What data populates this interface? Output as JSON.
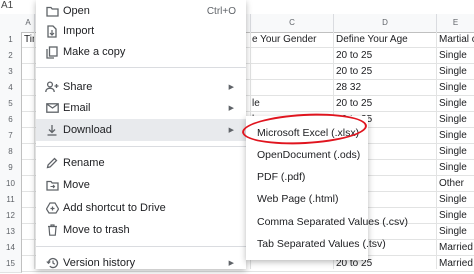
{
  "namebox": "A1",
  "sheet": {
    "columns": [
      "A",
      "B",
      "C",
      "D",
      "E"
    ],
    "rows": [
      "1",
      "2",
      "3",
      "4",
      "5",
      "6",
      "7",
      "8",
      "9",
      "10",
      "11",
      "12",
      "13",
      "14",
      "15"
    ],
    "row1": {
      "a": "Tin",
      "c": "e Your Gender",
      "d": "Define Your Age",
      "e": "Martial c"
    },
    "c_values": [
      "",
      "",
      "",
      "le",
      "le",
      "le",
      "",
      "",
      "",
      "",
      "",
      "",
      "",
      ""
    ],
    "d_values": [
      "20 to 25",
      "20 to 25",
      "28 32",
      "20 to 25",
      "20 to 25",
      "",
      "",
      "",
      "",
      "",
      "",
      "",
      "",
      "20 to 25"
    ],
    "e_values": [
      "Single",
      "Single",
      "Single",
      "Single",
      "Single",
      "Single",
      "Single",
      "Single",
      "Other",
      "Single",
      "Single",
      "Single",
      "Married",
      "Married"
    ]
  },
  "menu": {
    "open": "Open",
    "open_shortcut": "Ctrl+O",
    "import": "Import",
    "make_copy": "Make a copy",
    "share": "Share",
    "email": "Email",
    "download": "Download",
    "rename": "Rename",
    "move": "Move",
    "add_shortcut": "Add shortcut to Drive",
    "move_trash": "Move to trash",
    "version_history": "Version history"
  },
  "submenu": {
    "items": [
      "Microsoft Excel (.xlsx)",
      "OpenDocument (.ods)",
      "PDF (.pdf)",
      "Web Page (.html)",
      "Comma Separated Values (.csv)",
      "Tab Separated Values (.tsv)"
    ]
  },
  "colors": {
    "highlight": "#e0141e",
    "menu_active": "#e8eaed"
  }
}
